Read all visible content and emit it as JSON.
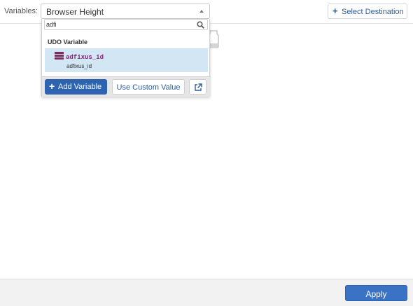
{
  "header": {
    "variables_label": "Variables:",
    "selected_variable": "Browser Height",
    "select_destination_label": "Select Destination"
  },
  "dropdown": {
    "search_value": "adfi",
    "group_label": "UDO Variable",
    "options": [
      {
        "name": "adfixus_id",
        "subtitle": "adfixus_id",
        "icon": "database-icon",
        "selected": true
      }
    ],
    "footer": {
      "add_variable_label": "Add Variable",
      "custom_value_label": "Use Custom Value",
      "external_link_icon": "external-link-icon"
    }
  },
  "footer": {
    "apply_label": "Apply"
  },
  "colors": {
    "primary": "#2e63b0",
    "link": "#2d5c98",
    "highlight": "#d3e6f4",
    "variable_name": "#8a1f78",
    "variable_icon": "#7a2c5b"
  }
}
